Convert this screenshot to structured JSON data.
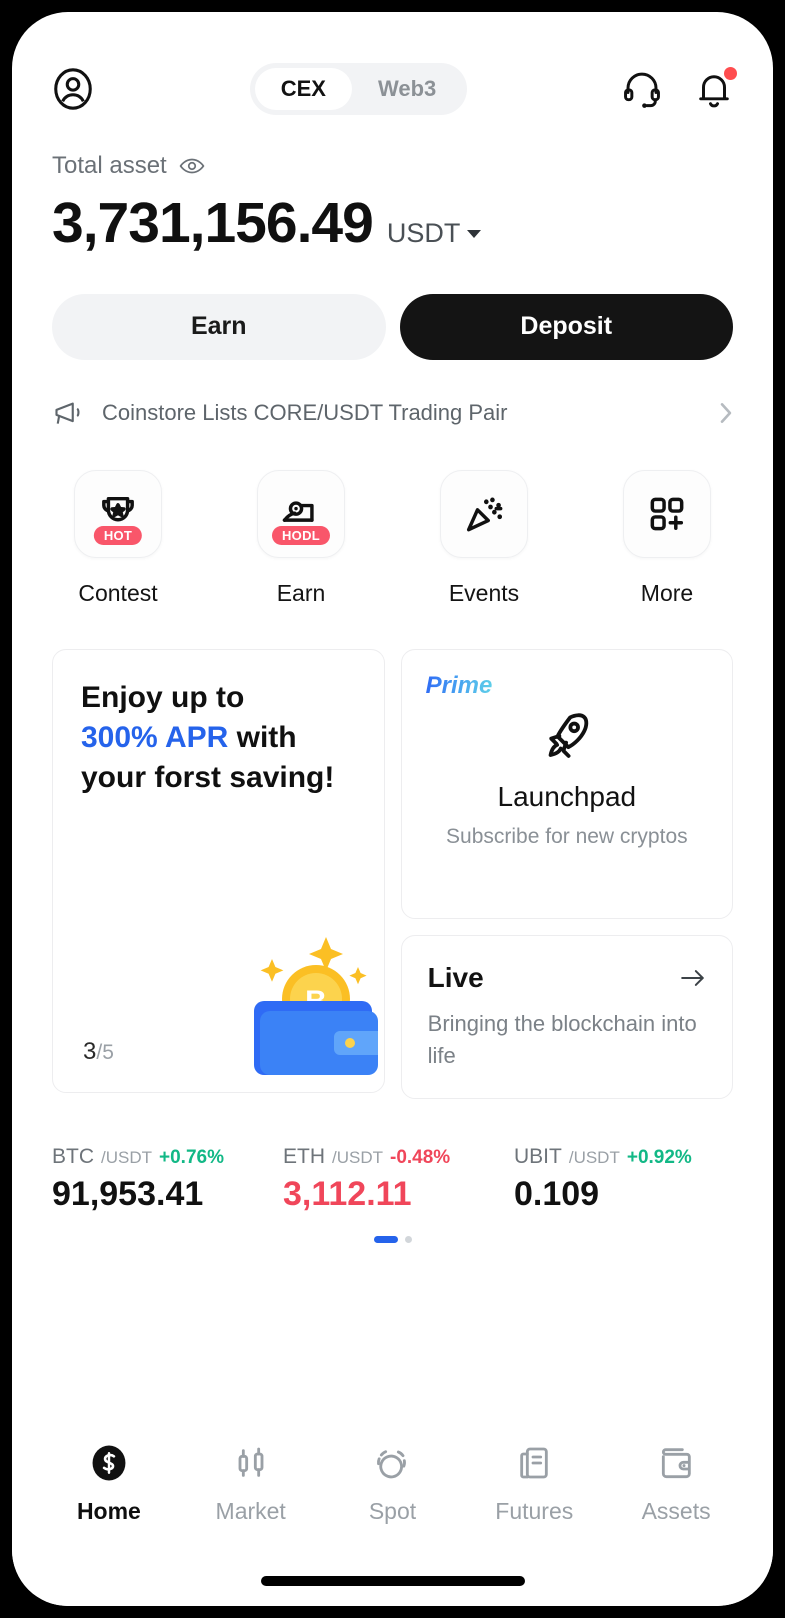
{
  "header": {
    "avatar_icon": "user-avatar-icon",
    "tabs": [
      {
        "label": "CEX",
        "active": true
      },
      {
        "label": "Web3",
        "active": false
      }
    ],
    "support_icon": "headset-icon",
    "notification_icon": "bell-icon",
    "notification_badge": true
  },
  "balance": {
    "label": "Total asset",
    "visibility_icon": "eye-icon",
    "amount": "3,731,156.49",
    "currency": "USDT",
    "currency_caret_icon": "chevron-down-icon"
  },
  "actions": {
    "earn_label": "Earn",
    "deposit_label": "Deposit"
  },
  "announcement": {
    "icon": "megaphone-icon",
    "text": "Coinstore Lists CORE/USDT Trading Pair",
    "chevron_icon": "chevron-right-icon"
  },
  "quick_actions": [
    {
      "label": "Contest",
      "icon": "trophy-icon",
      "badge": "HOT"
    },
    {
      "label": "Earn",
      "icon": "hodl-person-icon",
      "badge": "HODL"
    },
    {
      "label": "Events",
      "icon": "confetti-icon",
      "badge": ""
    },
    {
      "label": "More",
      "icon": "grid-plus-icon",
      "badge": ""
    }
  ],
  "promo": {
    "saving_card": {
      "line1": "Enjoy up to",
      "highlight": "300% APR",
      "line2_tail": " with",
      "line3": "your forst saving!",
      "art_icon": "wallet-bitcoin-icon",
      "page_current": "3",
      "page_total": "/5"
    },
    "launchpad_card": {
      "tag": "Prime",
      "icon": "rocket-icon",
      "title": "Launchpad",
      "subtitle": "Subscribe for new cryptos"
    },
    "live_card": {
      "title": "Live",
      "arrow_icon": "arrow-right-icon",
      "subtitle": "Bringing the blockchain into life"
    }
  },
  "tickers": [
    {
      "base": "BTC",
      "quote": "/USDT",
      "change": "+0.76%",
      "direction": "up",
      "price": "91,953.41"
    },
    {
      "base": "ETH",
      "quote": "/USDT",
      "change": "-0.48%",
      "direction": "down",
      "price": "3,112.11"
    },
    {
      "base": "UBIT",
      "quote": "/USDT",
      "change": "+0.92%",
      "direction": "up",
      "price": "0.109"
    }
  ],
  "ticker_pagination": {
    "total": 2,
    "active_index": 0
  },
  "bottom_nav": [
    {
      "label": "Home",
      "icon": "home-logo-icon",
      "active": true
    },
    {
      "label": "Market",
      "icon": "candlestick-icon",
      "active": false
    },
    {
      "label": "Spot",
      "icon": "spot-trade-icon",
      "active": false
    },
    {
      "label": "Futures",
      "icon": "document-icon",
      "active": false
    },
    {
      "label": "Assets",
      "icon": "wallet-icon",
      "active": false
    }
  ],
  "colors": {
    "accent_blue": "#2563eb",
    "up_green": "#12b886",
    "down_red": "#f0465a",
    "badge_red": "#f9566a",
    "primary_dark": "#141414"
  }
}
